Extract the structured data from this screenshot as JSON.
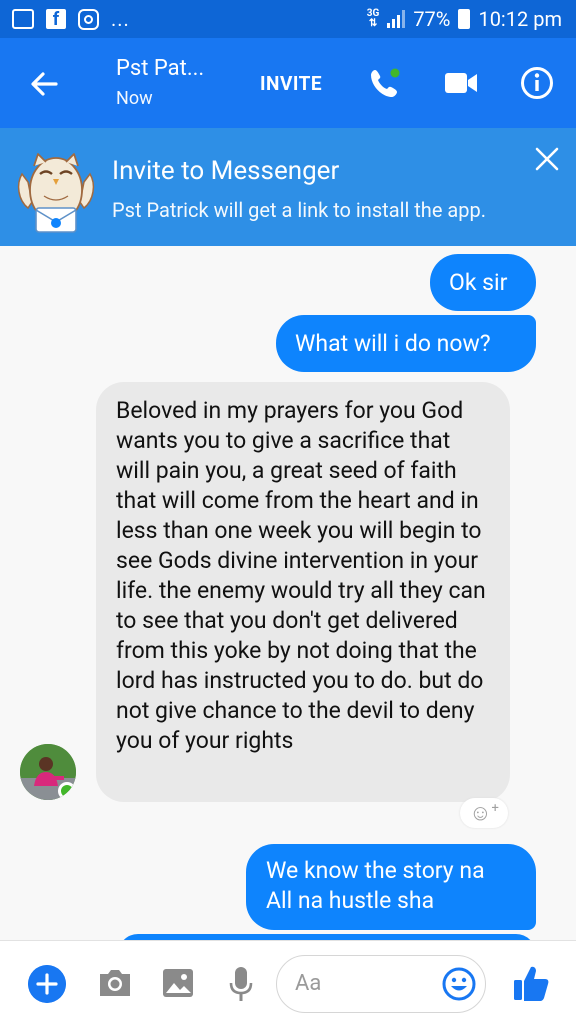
{
  "status_bar": {
    "network": "3G",
    "battery": "77%",
    "time": "10:12 pm",
    "overflow": "..."
  },
  "header": {
    "contact_name": "Pst Pat...",
    "presence": "Now",
    "invite_label": "INVITE"
  },
  "banner": {
    "title": "Invite to Messenger",
    "subtitle": "Pst Patrick will get a link to install the app."
  },
  "messages": [
    {
      "from": "me",
      "text": "Ok sir"
    },
    {
      "from": "me",
      "text": "What will i do now?"
    },
    {
      "from": "them",
      "text": "Beloved in my prayers for you God wants you to give a sacrifice that will pain you, a great seed of faith that will come from the heart and in less than one week you will begin to see Gods divine intervention in your life. the enemy would try all they can to see that you don't get delivered from this yoke by not doing that the lord has instructed you to do. but do not give chance to the devil to deny you of your rights"
    },
    {
      "from": "me",
      "text": "We know the story na All na hustle sha"
    }
  ],
  "composer": {
    "placeholder": "Aa"
  },
  "colors": {
    "header_blue": "#1877f2",
    "status_blue": "#0e66d6",
    "banner_blue": "#2e8fe6",
    "outgoing_bubble": "#0e84fd",
    "incoming_bubble": "#e9e9e9",
    "online_green": "#42b72a"
  },
  "icons": {
    "back": "arrow-left-icon",
    "call": "phone-icon",
    "video": "video-camera-icon",
    "info": "info-icon",
    "close": "close-icon",
    "add": "plus-icon",
    "camera": "camera-icon",
    "gallery": "image-icon",
    "mic": "microphone-icon",
    "emoji": "smiley-icon",
    "like": "thumbs-up-icon",
    "react": "add-reaction-icon"
  }
}
